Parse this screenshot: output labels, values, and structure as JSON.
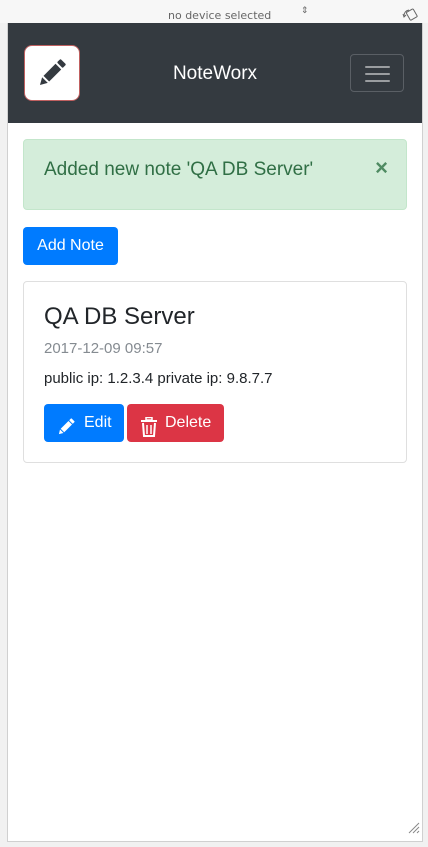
{
  "device_toolbar": {
    "device_select": "no device selected",
    "device_arrows": "⇕",
    "rotate_icon": "rotate-device-icon"
  },
  "navbar": {
    "brand": "NoteWorx",
    "logo_icon": "pencil-icon",
    "toggler_icon": "hamburger-menu-icon"
  },
  "alert": {
    "message": "Added new note 'QA DB Server'",
    "close": "×"
  },
  "add_note_label": "Add Note",
  "notes": [
    {
      "title": "QA DB Server",
      "date": "2017-12-09 09:57",
      "body": "public ip: 1.2.3.4 private ip: 9.8.7.7",
      "edit_label": "Edit",
      "delete_label": "Delete"
    }
  ],
  "colors": {
    "navbar": "#343a40",
    "primary": "#007bff",
    "danger": "#dc3545",
    "alert_bg": "#d4edda",
    "alert_text": "#306f45"
  }
}
